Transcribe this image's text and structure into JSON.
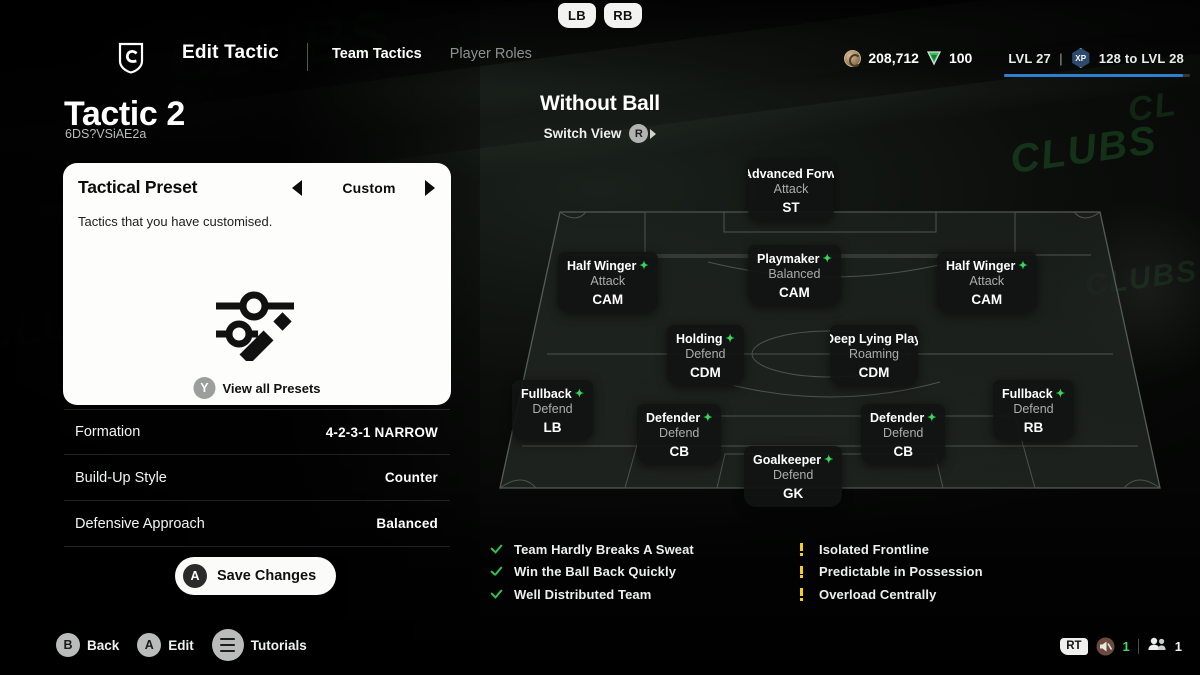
{
  "bumpers": [
    {
      "label": "LB"
    },
    {
      "label": "RB"
    }
  ],
  "header": {
    "crest_icon": "club-crest-icon",
    "title": "Edit Tactic",
    "tabs": [
      {
        "label": "Team Tactics",
        "active": true
      },
      {
        "label": "Player Roles",
        "active": false
      }
    ],
    "coins_icon": "coin-icon",
    "coins": "208,712",
    "points_icon": "gem-icon",
    "points": "100",
    "level_label": "LVL 27",
    "separator": "|",
    "xp_icon_label": "XP",
    "xp_to_next": "128 to LVL 28"
  },
  "left": {
    "tactic_name": "Tactic 2",
    "tactic_code": "6DS?VSiAE2a",
    "preset": {
      "title": "Tactical Preset",
      "value": "Custom",
      "description": "Tactics that you have customised.",
      "icon": "sliders-wand-icon",
      "view_all_button": "Y",
      "view_all_label": "View all Presets"
    },
    "settings": [
      {
        "label": "Formation",
        "value": "4-2-3-1 NARROW"
      },
      {
        "label": "Build-Up Style",
        "value": "Counter"
      },
      {
        "label": "Defensive Approach",
        "value": "Balanced"
      }
    ],
    "save_button": {
      "button": "A",
      "label": "Save Changes"
    }
  },
  "pitch": {
    "title": "Without Ball",
    "switch_view_label": "Switch View",
    "switch_view_button": "R",
    "players": [
      {
        "role": "Advanced Forward",
        "focus": "Attack",
        "pos": "ST",
        "clipped": true
      },
      {
        "role": "Half Winger",
        "focus": "Attack",
        "pos": "CAM",
        "clipped": false
      },
      {
        "role": "Playmaker",
        "focus": "Balanced",
        "pos": "CAM",
        "clipped": false
      },
      {
        "role": "Half Winger",
        "focus": "Attack",
        "pos": "CAM",
        "clipped": false
      },
      {
        "role": "Holding",
        "focus": "Defend",
        "pos": "CDM",
        "clipped": false
      },
      {
        "role": "Deep Lying Playmaker",
        "focus": "Roaming",
        "pos": "CDM",
        "clipped": true
      },
      {
        "role": "Fullback",
        "focus": "Defend",
        "pos": "LB",
        "clipped": false
      },
      {
        "role": "Defender",
        "focus": "Defend",
        "pos": "CB",
        "clipped": false
      },
      {
        "role": "Defender",
        "focus": "Defend",
        "pos": "CB",
        "clipped": false
      },
      {
        "role": "Fullback",
        "focus": "Defend",
        "pos": "RB",
        "clipped": false
      },
      {
        "role": "Goalkeeper",
        "focus": "Defend",
        "pos": "GK",
        "clipped": false
      }
    ]
  },
  "feedback": {
    "strengths": [
      "Team Hardly Breaks A Sweat",
      "Win the Ball Back Quickly",
      "Well Distributed Team"
    ],
    "weaknesses": [
      "Isolated Frontline",
      "Predictable in Possession",
      "Overload Centrally"
    ]
  },
  "footer": {
    "items": [
      {
        "button": "B",
        "label": "Back"
      },
      {
        "button": "A",
        "label": "Edit"
      },
      {
        "button": "menu",
        "label": "Tutorials"
      }
    ],
    "right": {
      "trigger": "RT",
      "mic_icon": "mic-muted-icon",
      "voice_count": "1",
      "party_icon": "people-icon",
      "party_count": "1"
    }
  },
  "colors": {
    "accent_green": "#34d95c",
    "warn_yellow": "#f5cf1e",
    "xp_blue": "#2f7fd0",
    "panel_white": "#fdfdfb"
  }
}
